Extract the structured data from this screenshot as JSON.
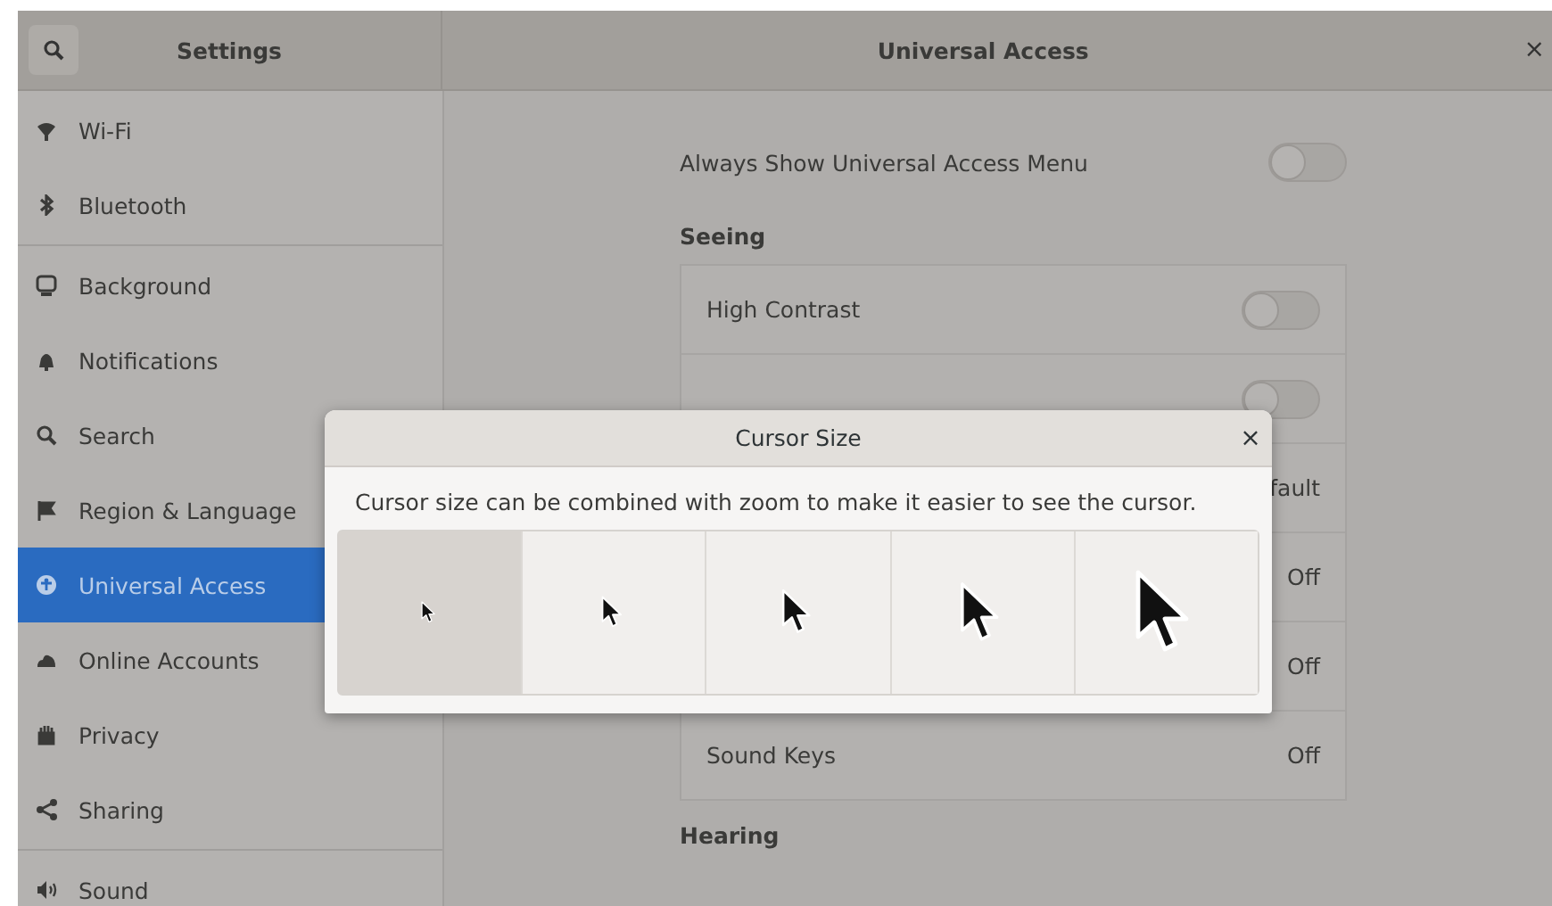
{
  "window": {
    "sidebar_title": "Settings",
    "title": "Universal Access",
    "close": "×"
  },
  "sidebar": {
    "groups": [
      [
        {
          "label": "Wi-Fi",
          "kind": "wifi",
          "selected": false
        },
        {
          "label": "Bluetooth",
          "kind": "bluetooth",
          "selected": false
        }
      ],
      [
        {
          "label": "Background",
          "kind": "monitor",
          "selected": false
        },
        {
          "label": "Notifications",
          "kind": "bell",
          "selected": false
        },
        {
          "label": "Search",
          "kind": "search",
          "selected": false
        },
        {
          "label": "Region & Language",
          "kind": "flag",
          "selected": false
        },
        {
          "label": "Universal Access",
          "kind": "access",
          "selected": true
        },
        {
          "label": "Online Accounts",
          "kind": "cloud",
          "selected": false
        },
        {
          "label": "Privacy",
          "kind": "hand",
          "selected": false
        },
        {
          "label": "Sharing",
          "kind": "share",
          "selected": false
        }
      ],
      [
        {
          "label": "Sound",
          "kind": "speaker",
          "selected": false
        }
      ]
    ]
  },
  "content": {
    "menu_toggle": {
      "label": "Always Show Universal Access Menu",
      "on": false
    },
    "sections": [
      {
        "heading": "Seeing",
        "rows": [
          {
            "kind": "switch",
            "label": "High Contrast",
            "on": false
          },
          {
            "kind": "switch",
            "on": false
          },
          {
            "kind": "value",
            "value": "fault"
          },
          {
            "kind": "value",
            "value": "Off"
          },
          {
            "kind": "value",
            "value": "Off"
          },
          {
            "kind": "value",
            "label": "Sound Keys",
            "value": "Off"
          }
        ]
      },
      {
        "heading": "Hearing"
      }
    ]
  },
  "dialog": {
    "title": "Cursor Size",
    "close": "×",
    "description": "Cursor size can be combined with zoom to make it easier to see the cursor.",
    "sizes": [
      {
        "selected": true
      },
      {
        "selected": false
      },
      {
        "selected": false
      },
      {
        "selected": false
      },
      {
        "selected": false
      }
    ]
  }
}
